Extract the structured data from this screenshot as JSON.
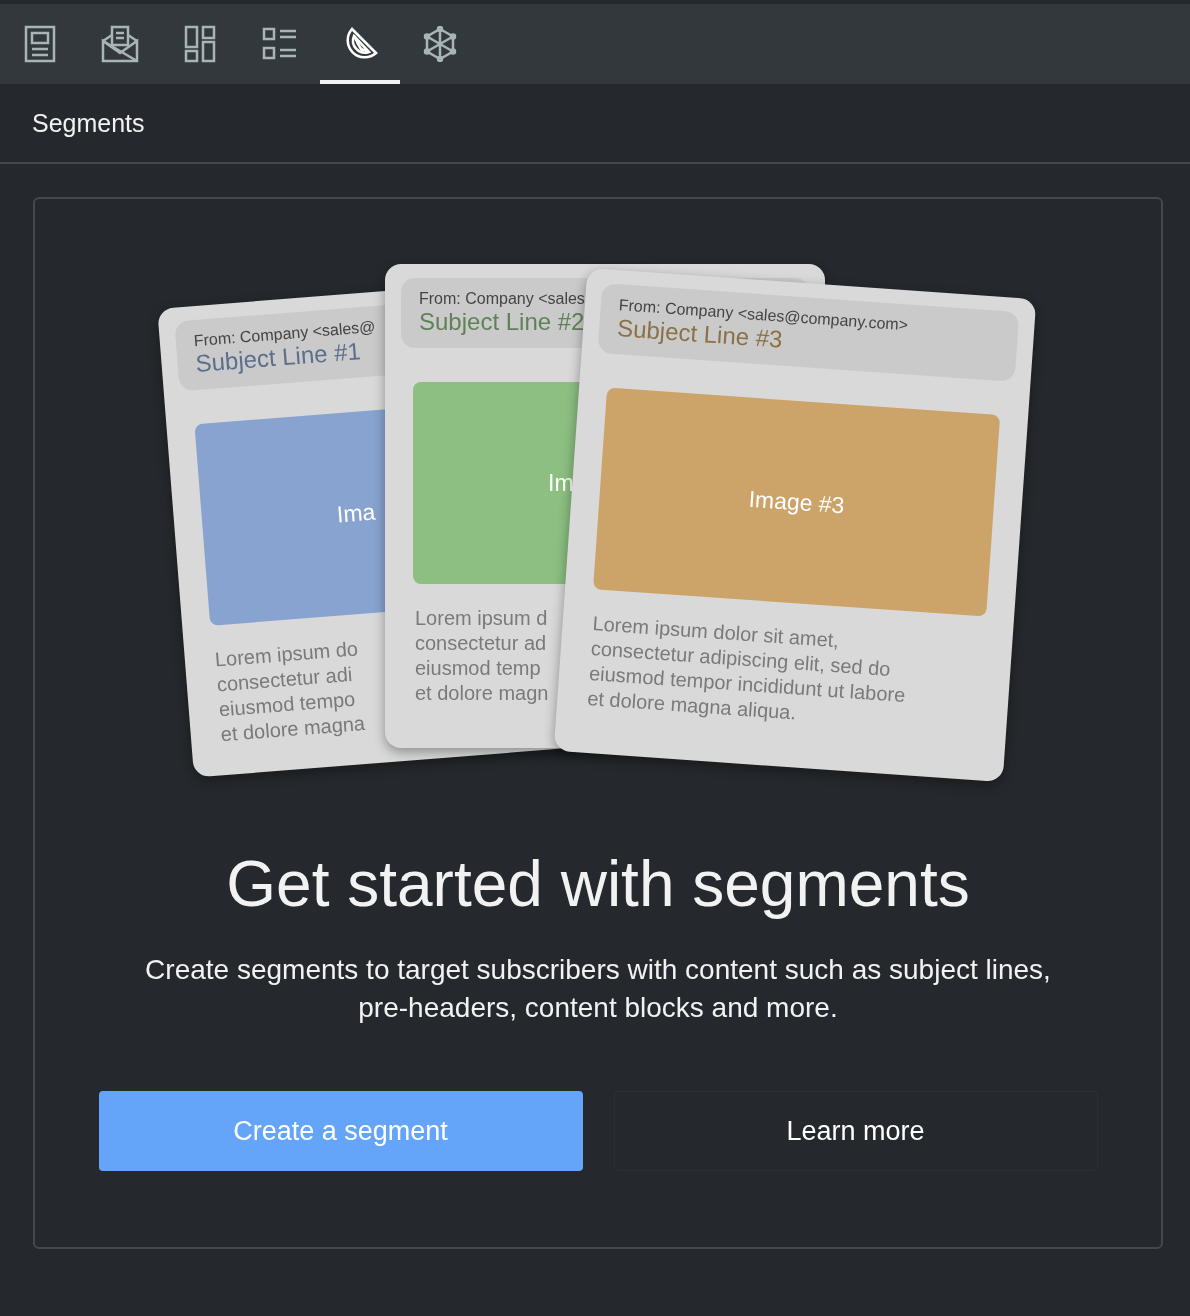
{
  "tabs": [
    {
      "selected": false
    },
    {
      "selected": false
    },
    {
      "selected": false
    },
    {
      "selected": false
    },
    {
      "selected": true
    },
    {
      "selected": false
    }
  ],
  "panel_title": "Segments",
  "illustration": {
    "cards": [
      {
        "from": "From: Company <sales@",
        "subject": "Subject Line #1",
        "image_label": "Ima",
        "color": "#88a3d0",
        "body": [
          "Lorem ipsum do",
          "consectetur adi",
          "eiusmod  tempo",
          "et dolore magna"
        ]
      },
      {
        "from": "From: Company <sales",
        "subject": "Subject Line #2",
        "image_label": "Im",
        "color": "#8cbf80",
        "body": [
          "Lorem ipsum d",
          "consectetur ad",
          "eiusmod  temp",
          "et dolore magn"
        ]
      },
      {
        "from": "From: Company <sales@company.com>",
        "subject": "Subject Line #3",
        "image_label": "Image #3",
        "color": "#cca46a",
        "body": [
          "Lorem ipsum dolor sit amet,",
          "consectetur adipiscing elit, sed do",
          "eiusmod  tempor incididunt ut labore",
          "et dolore magna aliqua."
        ]
      }
    ]
  },
  "heading": "Get started with segments",
  "description": "Create segments to target subscribers with content such as subject lines, pre-headers, content blocks and more.",
  "buttons": [
    {
      "label": "Create a segment",
      "kind": "primary"
    },
    {
      "label": "Learn more",
      "kind": "secondary"
    }
  ]
}
